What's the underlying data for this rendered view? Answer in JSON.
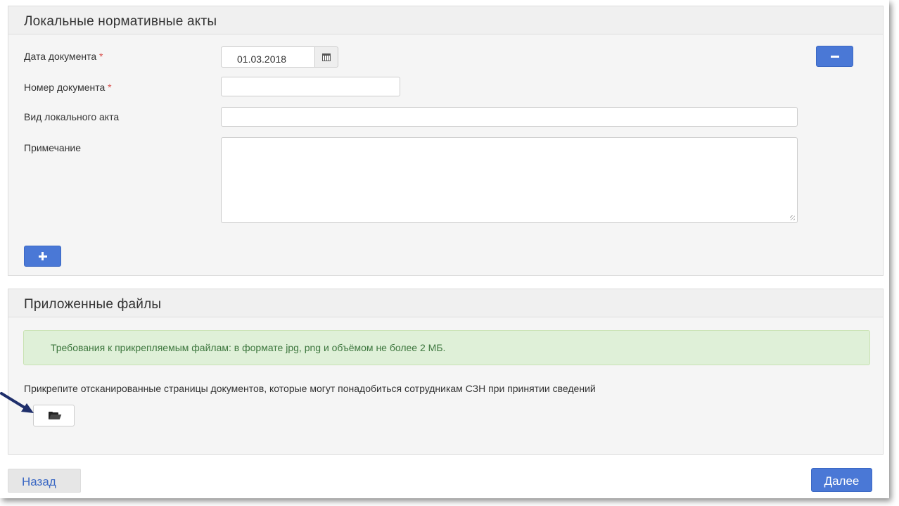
{
  "acts_panel": {
    "title": "Локальные нормативные акты",
    "date_label": "Дата документа",
    "number_label": "Номер документа",
    "required_mark": "*",
    "type_label": "Вид локального акта",
    "note_label": "Примечание",
    "date_value": "01.03.2018",
    "number_value": "",
    "type_value": "",
    "note_value": "",
    "calendar_icon": "calendar-icon",
    "remove_icon": "minus-icon",
    "add_icon": "plus-icon"
  },
  "files_panel": {
    "title": "Приложенные файлы",
    "requirements": "Требования к прикрепляемым файлам: в формате jpg, png и объёмом не более 2 МБ.",
    "attach_hint": "Прикрепите отсканированные страницы документов, которые могут понадобиться сотрудникам СЗН при принятии сведений",
    "folder_icon": "folder-open-icon"
  },
  "nav": {
    "back_label": "Назад",
    "next_label": "Далее"
  },
  "colors": {
    "primary": "#4a78d6",
    "required": "#d9534f",
    "alert_bg": "#dff0d8",
    "alert_text": "#3c763d",
    "arrow": "#1f2f6b"
  }
}
